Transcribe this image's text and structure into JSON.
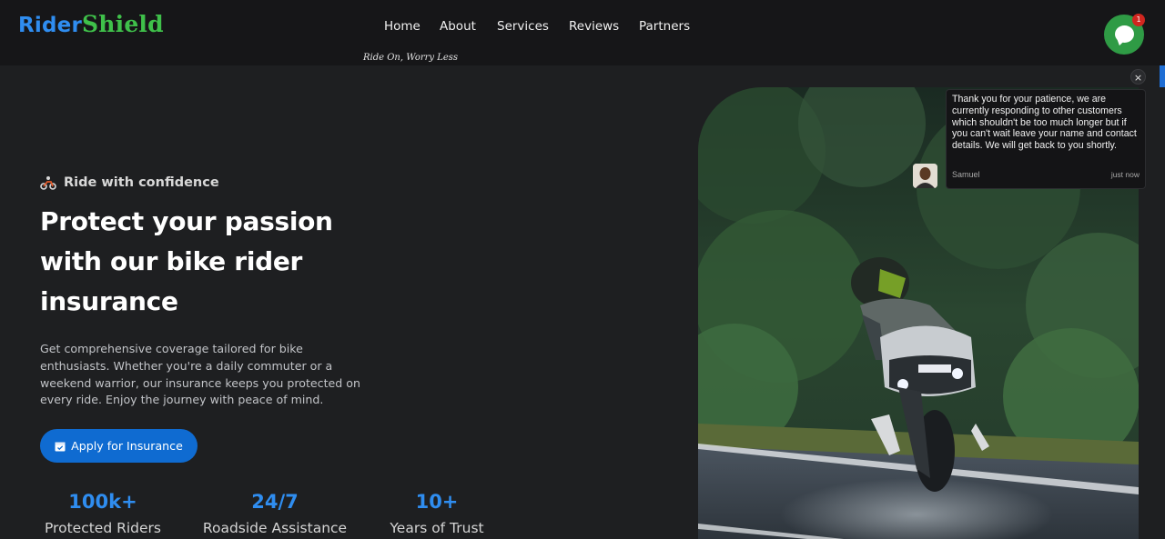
{
  "brand": {
    "part1": "Rider",
    "part2": "Shield",
    "tagline": "Ride On, Worry Less"
  },
  "nav": {
    "items": [
      "Home",
      "About",
      "Services",
      "Reviews",
      "Partners"
    ]
  },
  "chat": {
    "badge_count": "1",
    "close_label": "×",
    "message": "Thank you for your patience, we are currently responding to other customers which shouldn't be too much longer but if you can't wait leave your name and contact details. We will get back to you shortly.",
    "agent_name": "Samuel",
    "time": "just now",
    "accent_color": "#2f9b45"
  },
  "hero": {
    "eyebrow": "Ride with confidence",
    "headline": "Protect your passion with our bike rider insurance",
    "description": "Get comprehensive coverage tailored for bike enthusiasts. Whether you're a daily commuter or a weekend warrior, our insurance keeps you protected on every ride. Enjoy the journey with peace of mind.",
    "cta_label": "Apply for Insurance",
    "cta_color": "#0f6bd1"
  },
  "stats": [
    {
      "value": "100k+",
      "label": "Protected Riders"
    },
    {
      "value": "24/7",
      "label": "Roadside Assistance"
    },
    {
      "value": "10+",
      "label": "Years of Trust"
    }
  ],
  "icons": {
    "eyebrow": "motorcycle-icon",
    "cta": "calendar-check-icon",
    "chat": "chat-bubble-icon"
  }
}
